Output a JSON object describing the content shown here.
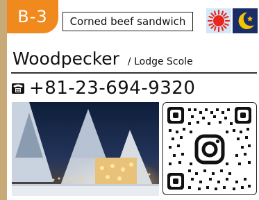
{
  "code": "B-3",
  "menu_item": "Corned beef sandwich",
  "icons": {
    "daytime": "sun-icon",
    "nighttime": "moon-icon"
  },
  "shop": {
    "name": "Woodpecker",
    "location": "/ Lodge Scole"
  },
  "phone": {
    "icon": "telephone-icon",
    "number": "+81-23-694-9320"
  },
  "colors": {
    "accent": "#f08a1e",
    "background": "#c8a978",
    "sun": "#e8261c",
    "moon": "#f5c400",
    "moon_bg": "#1a2d68"
  }
}
